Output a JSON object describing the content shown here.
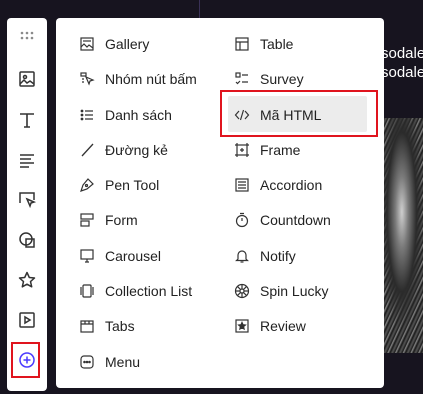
{
  "colors": {
    "accent_red": "#e0141e",
    "background": "#17141f",
    "active_icon": "#4a3aff"
  },
  "background": {
    "text_lines": [
      "sodale",
      "sodale"
    ]
  },
  "sidebar": {
    "items": [
      {
        "icon": "drag-handle-icon"
      },
      {
        "icon": "image-icon"
      },
      {
        "icon": "text-icon"
      },
      {
        "icon": "paragraph-icon"
      },
      {
        "icon": "cursor-select-icon"
      },
      {
        "icon": "shapes-icon"
      },
      {
        "icon": "star-icon"
      },
      {
        "icon": "video-icon"
      },
      {
        "icon": "add-circle-icon",
        "active": true
      }
    ]
  },
  "menu": {
    "left": [
      {
        "label": "Gallery",
        "icon": "gallery-icon"
      },
      {
        "label": "Nhóm nút bấm",
        "icon": "button-group-icon"
      },
      {
        "label": "Danh sách",
        "icon": "list-icon"
      },
      {
        "label": "Đường kẻ",
        "icon": "line-icon"
      },
      {
        "label": "Pen Tool",
        "icon": "pen-tool-icon"
      },
      {
        "label": "Form",
        "icon": "form-icon"
      },
      {
        "label": "Carousel",
        "icon": "carousel-icon"
      },
      {
        "label": "Collection List",
        "icon": "collection-list-icon"
      },
      {
        "label": "Tabs",
        "icon": "tabs-icon"
      },
      {
        "label": "Menu",
        "icon": "menu-icon"
      }
    ],
    "right": [
      {
        "label": "Table",
        "icon": "table-icon"
      },
      {
        "label": "Survey",
        "icon": "survey-icon"
      },
      {
        "label": "Mã HTML",
        "icon": "code-icon",
        "highlighted": true
      },
      {
        "label": "Frame",
        "icon": "frame-icon"
      },
      {
        "label": "Accordion",
        "icon": "accordion-icon"
      },
      {
        "label": "Countdown",
        "icon": "countdown-icon"
      },
      {
        "label": "Notify",
        "icon": "bell-icon"
      },
      {
        "label": "Spin Lucky",
        "icon": "spin-wheel-icon"
      },
      {
        "label": "Review",
        "icon": "review-icon"
      }
    ]
  }
}
